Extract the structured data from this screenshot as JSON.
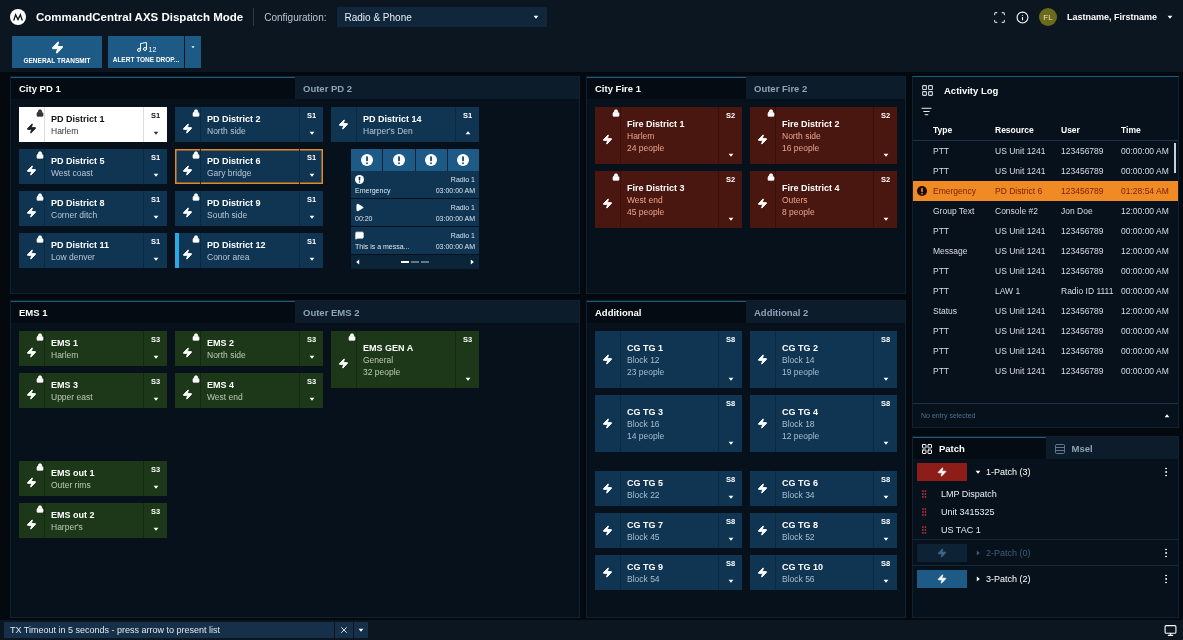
{
  "header": {
    "title": "CommandCentral AXS Dispatch Mode",
    "config_label": "Configuration:",
    "config_value": "Radio & Phone",
    "user_initials": "FL",
    "user_name": "Lastname, Firstname"
  },
  "toolbar": [
    {
      "kind": "transmit",
      "label": "GENERAL TRANSMIT"
    },
    {
      "kind": "alert_tone",
      "label": "ALERT TONE DROP...",
      "badge": "12"
    }
  ],
  "panels": [
    {
      "kind": "police",
      "tabs": [
        {
          "label": "City PD 1",
          "selected": true
        },
        {
          "label": "Outer PD 2",
          "selected": false
        }
      ],
      "columns": [
        [
          [
            {
              "name": "PD District 1",
              "area": "Harlem",
              "slot": "S1",
              "locked": true,
              "selected": true
            },
            {
              "name": "PD District 5",
              "area": "West coast",
              "slot": "S1",
              "locked": true,
              "selected": false
            },
            {
              "name": "PD District 8",
              "area": "Corner ditch",
              "slot": "S1",
              "locked": true,
              "selected": false
            },
            {
              "name": "PD District 11",
              "area": "Low denver",
              "slot": "S1",
              "locked": true,
              "selected": false
            }
          ]
        ],
        [
          [
            {
              "name": "PD District 2",
              "area": "North side",
              "slot": "S1",
              "locked": true,
              "selected": false
            },
            {
              "name": "PD District 6",
              "area": "Gary bridge",
              "slot": "S1",
              "locked": true,
              "selected": false,
              "emergency": true
            },
            {
              "name": "PD District 9",
              "area": "South side",
              "slot": "S1",
              "locked": true,
              "selected": false
            },
            {
              "name": "PD District 12",
              "area": "Conor area",
              "slot": "S1",
              "locked": true,
              "selected": false,
              "active": true
            }
          ]
        ],
        [
          [
            {
              "name": "PD District 14",
              "area": "Harper's Den",
              "slot": "S1",
              "locked": false,
              "selected": false,
              "expanded": true,
              "detail": {
                "actions": [
                  {
                    "kind": "emergency"
                  },
                  {
                    "kind": "emergency"
                  },
                  {
                    "kind": "emergency"
                  },
                  {
                    "kind": "emergency"
                  }
                ],
                "entries": [
                  {
                    "kind": "emergency",
                    "source": "Radio 1",
                    "label": "Emergency",
                    "time": "03:00:00 AM"
                  },
                  {
                    "kind": "audio",
                    "source": "Radio 1",
                    "label": "00:20",
                    "time": "03:00:00 AM"
                  },
                  {
                    "kind": "message",
                    "source": "Radio 1",
                    "label": "This is a messa...",
                    "time": "03:00:00 AM"
                  }
                ],
                "pages": [
                  {
                    "selected": true
                  },
                  {
                    "selected": false
                  },
                  {
                    "selected": false
                  }
                ]
              }
            }
          ]
        ]
      ]
    },
    {
      "kind": "fire",
      "tabs": [
        {
          "label": "City Fire 1",
          "selected": true
        },
        {
          "label": "Outer Fire 2",
          "selected": false
        }
      ],
      "columns": [
        [
          [
            {
              "name": "Fire District 1",
              "area": "Harlem",
              "people": "24 people",
              "slot": "S2",
              "locked": true,
              "selected": false
            },
            {
              "name": "Fire District 3",
              "area": "West end",
              "people": "45 people",
              "slot": "S2",
              "locked": true,
              "selected": false
            }
          ]
        ],
        [
          [
            {
              "name": "Fire District 2",
              "area": "North side",
              "people": "16 people",
              "slot": "S2",
              "locked": true,
              "selected": false
            },
            {
              "name": "Fire District 4",
              "area": "Outers",
              "people": "8 people",
              "slot": "S2",
              "locked": true,
              "selected": false
            }
          ]
        ]
      ]
    },
    {
      "kind": "ems",
      "tabs": [
        {
          "label": "EMS 1",
          "selected": true
        },
        {
          "label": "Outer EMS 2",
          "selected": false
        }
      ],
      "columns": [
        [
          [
            {
              "name": "EMS 1",
              "area": "Harlem",
              "slot": "S3",
              "locked": true,
              "selected": false
            },
            {
              "name": "EMS 3",
              "area": "Upper east",
              "slot": "S3",
              "locked": true,
              "selected": false
            }
          ],
          [
            {
              "name": "EMS out 1",
              "area": "Outer rims",
              "slot": "S3",
              "locked": true,
              "selected": false
            },
            {
              "name": "EMS out 2",
              "area": "Harper's",
              "slot": "S3",
              "locked": true,
              "selected": false
            }
          ]
        ],
        [
          [
            {
              "name": "EMS 2",
              "area": "North side",
              "slot": "S3",
              "locked": true,
              "selected": false
            },
            {
              "name": "EMS 4",
              "area": "West end",
              "slot": "S3",
              "locked": true,
              "selected": false
            }
          ]
        ],
        [
          [
            {
              "name": "EMS GEN A",
              "area": "General",
              "people": "32 people",
              "slot": "S3",
              "locked": true,
              "selected": false
            }
          ]
        ]
      ]
    },
    {
      "kind": "talkgroup",
      "tabs": [
        {
          "label": "Additional",
          "selected": true
        },
        {
          "label": "Additional 2",
          "selected": false
        }
      ],
      "columns": [
        [
          [
            {
              "name": "CG TG 1",
              "area": "Block 12",
              "people": "23 people",
              "slot": "S8",
              "locked": false,
              "selected": false
            },
            {
              "name": "CG TG 3",
              "area": "Block 16",
              "people": "14 people",
              "slot": "S8",
              "locked": false,
              "selected": false
            }
          ],
          [
            {
              "name": "CG TG 5",
              "area": "Block 22",
              "slot": "S8",
              "locked": false,
              "selected": false
            },
            {
              "name": "CG TG 7",
              "area": "Block 45",
              "slot": "S8",
              "locked": false,
              "selected": false
            },
            {
              "name": "CG TG 9",
              "area": "Block 54",
              "slot": "S8",
              "locked": false,
              "selected": false
            }
          ]
        ],
        [
          [
            {
              "name": "CG TG 2",
              "area": "Block 14",
              "people": "19 people",
              "slot": "S8",
              "locked": false,
              "selected": false
            },
            {
              "name": "CG TG 4",
              "area": "Block 18",
              "people": "12 people",
              "slot": "S8",
              "locked": false,
              "selected": false
            }
          ],
          [
            {
              "name": "CG TG 6",
              "area": "Block 34",
              "slot": "S8",
              "locked": false,
              "selected": false
            },
            {
              "name": "CG TG 8",
              "area": "Block 52",
              "slot": "S8",
              "locked": false,
              "selected": false
            },
            {
              "name": "CG TG 10",
              "area": "Block 56",
              "slot": "S8",
              "locked": false,
              "selected": false
            }
          ]
        ]
      ]
    }
  ],
  "activity_log": {
    "title": "Activity Log",
    "columns": [
      "Type",
      "Resource",
      "User",
      "Time"
    ],
    "rows": [
      {
        "kind": "event",
        "type": "PTT",
        "resource": "US Unit 1241",
        "user": "123456789",
        "time": "00:00:00 AM"
      },
      {
        "kind": "event",
        "type": "PTT",
        "resource": "US Unit 1241",
        "user": "123456789",
        "time": "00:00:00 AM"
      },
      {
        "kind": "emergency",
        "type": "Emergency",
        "resource": "PD District 6",
        "user": "123456789",
        "time": "01:28:54 AM"
      },
      {
        "kind": "event",
        "type": "Group Text",
        "resource": "Console #2",
        "user": "Jon Doe",
        "time": "12:00:00 AM"
      },
      {
        "kind": "event",
        "type": "PTT",
        "resource": "US Unit 1241",
        "user": "123456789",
        "time": "00:00:00 AM"
      },
      {
        "kind": "event",
        "type": "Message",
        "resource": "US Unit 1241",
        "user": "123456789",
        "time": "12:00:00 AM"
      },
      {
        "kind": "event",
        "type": "PTT",
        "resource": "US Unit 1241",
        "user": "123456789",
        "time": "00:00:00 AM"
      },
      {
        "kind": "event",
        "type": "PTT",
        "resource": "LAW 1",
        "user": "Radio ID 1111",
        "time": "00:00:00 AM"
      },
      {
        "kind": "event",
        "type": "Status",
        "resource": "US Unit 1241",
        "user": "123456789",
        "time": "12:00:00 AM"
      },
      {
        "kind": "event",
        "type": "PTT",
        "resource": "US Unit 1241",
        "user": "123456789",
        "time": "00:00:00 AM"
      },
      {
        "kind": "event",
        "type": "PTT",
        "resource": "US Unit 1241",
        "user": "123456789",
        "time": "00:00:00 AM"
      },
      {
        "kind": "event",
        "type": "PTT",
        "resource": "US Unit 1241",
        "user": "123456789",
        "time": "00:00:00 AM"
      }
    ],
    "footer": "No entry selected"
  },
  "patch_panel": {
    "tabs": [
      {
        "label": "Patch",
        "selected": true
      },
      {
        "label": "Msel",
        "selected": false
      }
    ],
    "patches": [
      {
        "label": "1-Patch (3)",
        "transmitting": true,
        "disabled": false,
        "expanded": true,
        "members": [
          "LMP Dispatch",
          "Unit 3415325",
          "US TAC 1"
        ]
      },
      {
        "label": "2-Patch (0)",
        "transmitting": false,
        "disabled": true,
        "expanded": false
      },
      {
        "label": "3-Patch (2)",
        "transmitting": false,
        "disabled": false,
        "expanded": false
      }
    ]
  },
  "status_bar": {
    "message": "TX Timeout in 5 seconds - press arrow to present list"
  }
}
